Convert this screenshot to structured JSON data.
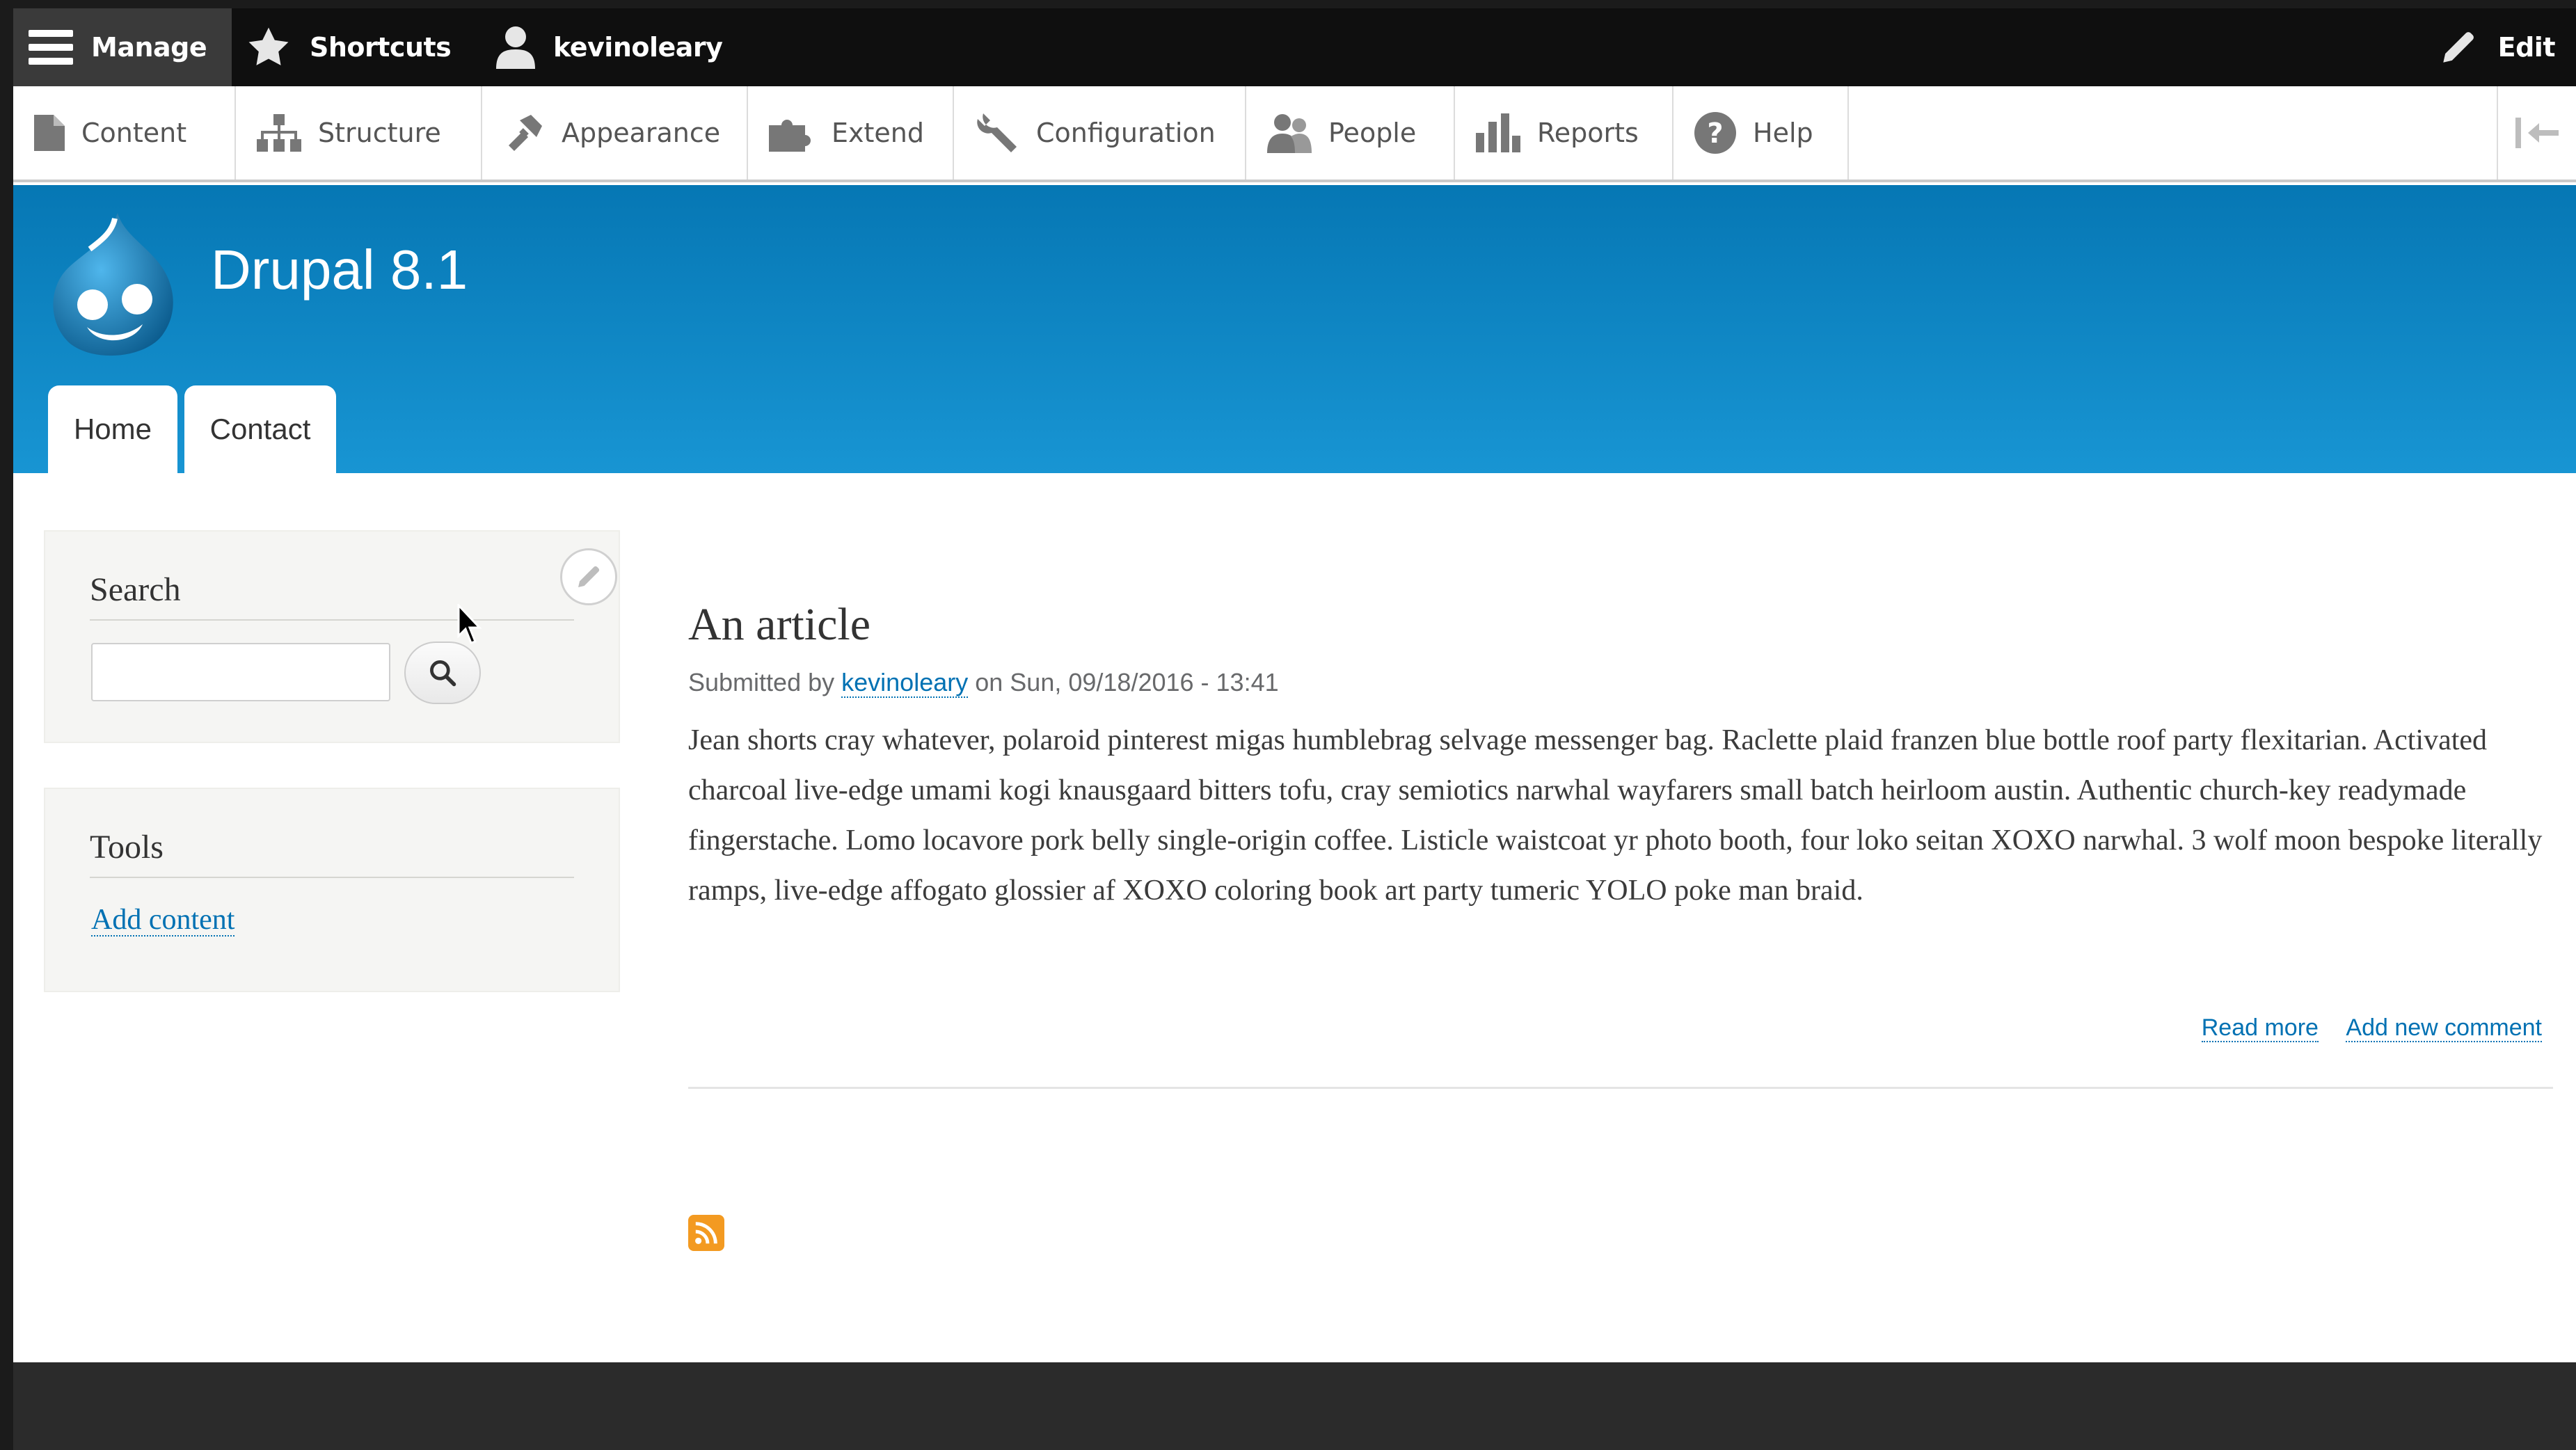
{
  "admin_toolbar": {
    "manage": "Manage",
    "shortcuts": "Shortcuts",
    "user": "kevinoleary",
    "edit": "Edit"
  },
  "admin_tray": {
    "items": [
      {
        "label": "Content",
        "icon": "file-icon"
      },
      {
        "label": "Structure",
        "icon": "sitemap-icon"
      },
      {
        "label": "Appearance",
        "icon": "paintbrush-icon"
      },
      {
        "label": "Extend",
        "icon": "puzzle-icon"
      },
      {
        "label": "Configuration",
        "icon": "wrench-icon"
      },
      {
        "label": "People",
        "icon": "people-icon"
      },
      {
        "label": "Reports",
        "icon": "bar-chart-icon"
      },
      {
        "label": "Help",
        "icon": "help-icon"
      }
    ]
  },
  "header": {
    "site_name": "Drupal 8.1",
    "tabs": [
      {
        "label": "Home"
      },
      {
        "label": "Contact"
      }
    ],
    "colors": {
      "top": "#0677b4",
      "bottom": "#1895d3"
    }
  },
  "sidebar": {
    "search": {
      "title": "Search",
      "value": "",
      "placeholder": ""
    },
    "tools": {
      "title": "Tools",
      "link": "Add content"
    }
  },
  "article": {
    "title": "An article",
    "meta_prefix": "Submitted by",
    "author": "kevinoleary",
    "meta_suffix": "on Sun, 09/18/2016 - 13:41",
    "body": "Jean shorts cray whatever, polaroid pinterest migas humblebrag selvage messenger bag. Raclette plaid franzen blue bottle roof party flexitarian. Activated charcoal live-edge umami kogi knausgaard bitters tofu, cray semiotics narwhal wayfarers small batch heirloom austin. Authentic church-key readymade fingerstache. Lomo locavore pork belly single-origin coffee. Listicle waistcoat yr photo booth, four loko seitan XOXO narwhal. 3 wolf moon bespoke literally ramps, live-edge affogato glossier af XOXO coloring book art party tumeric YOLO poke man braid.",
    "read_more": "Read more",
    "add_comment": "Add new comment"
  },
  "colors": {
    "link": "#0071b3",
    "rss": "#f39a21",
    "footer": "#2b2b2b"
  }
}
